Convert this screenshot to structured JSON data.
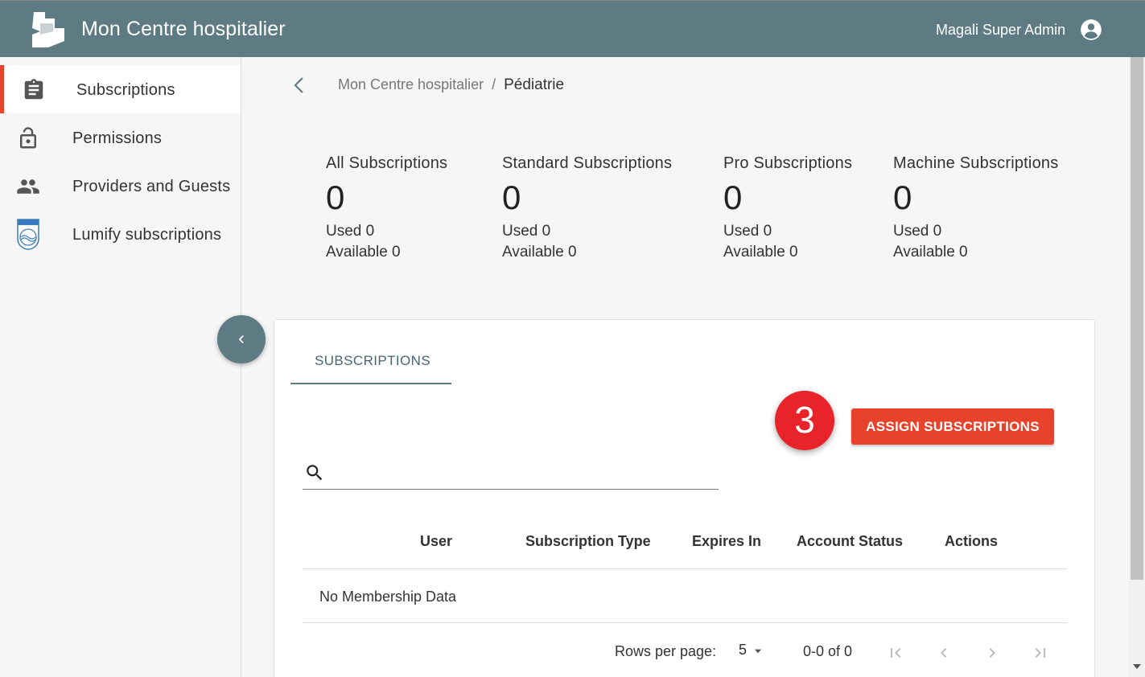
{
  "header": {
    "app_title": "Mon Centre hospitalier",
    "user_name": "Magali Super Admin",
    "bar_color": "#5e7b83"
  },
  "sidebar": {
    "items": [
      {
        "label": "Subscriptions",
        "icon": "clipboard-icon",
        "active": true
      },
      {
        "label": "Permissions",
        "icon": "lock-icon",
        "active": false
      },
      {
        "label": "Providers and Guests",
        "icon": "people-icon",
        "active": false
      },
      {
        "label": "Lumify subscriptions",
        "icon": "philips-logo-icon",
        "active": false
      }
    ],
    "active_color": "#e8422a"
  },
  "breadcrumb": {
    "parent": "Mon Centre hospitalier",
    "separator": "/",
    "current": "Pédiatrie"
  },
  "stats": [
    {
      "title": "All Subscriptions",
      "total": "0",
      "used": "Used 0",
      "available": "Available 0"
    },
    {
      "title": "Standard Subscriptions",
      "total": "0",
      "used": "Used 0",
      "available": "Available 0"
    },
    {
      "title": "Pro Subscriptions",
      "total": "0",
      "used": "Used 0",
      "available": "Available 0"
    },
    {
      "title": "Machine Subscriptions",
      "total": "0",
      "used": "Used 0",
      "available": "Available 0"
    }
  ],
  "card": {
    "tab_label": "SUBSCRIPTIONS",
    "step_badge": "3",
    "assign_button": "ASSIGN SUBSCRIPTIONS",
    "search": {
      "value": "",
      "placeholder": ""
    },
    "table": {
      "columns": [
        "User",
        "Subscription Type",
        "Expires In",
        "Account Status",
        "Actions"
      ],
      "empty_message": "No Membership Data"
    },
    "pagination": {
      "rows_per_page_label": "Rows per page:",
      "rows_per_page_value": "5",
      "range": "0-0 of 0"
    }
  }
}
